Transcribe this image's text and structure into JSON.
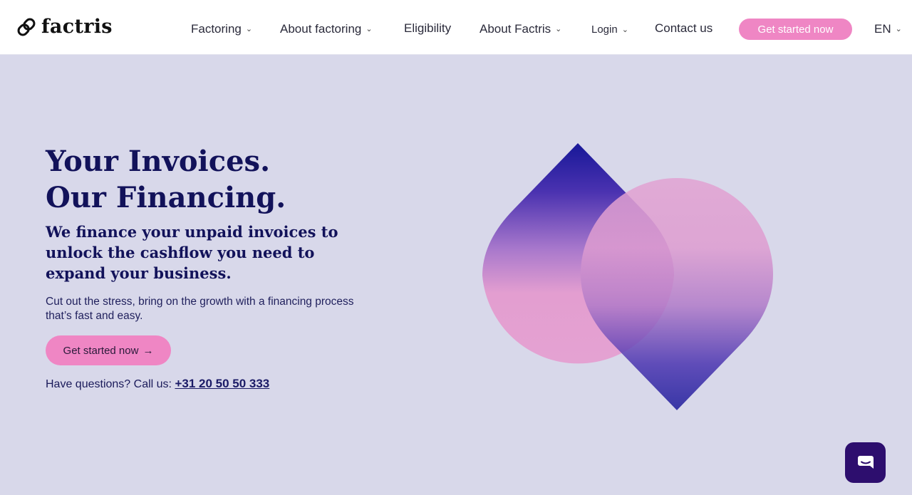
{
  "brand": {
    "name": "factris"
  },
  "nav": {
    "items": [
      {
        "label": "Factoring",
        "has_dropdown": true
      },
      {
        "label": "About factoring",
        "has_dropdown": true
      },
      {
        "label": "Eligibility",
        "has_dropdown": false
      },
      {
        "label": "About Factris",
        "has_dropdown": true
      },
      {
        "label": "Login",
        "has_dropdown": true
      },
      {
        "label": "Contact us",
        "has_dropdown": false
      }
    ],
    "cta_label": "Get started now",
    "language": "EN"
  },
  "hero": {
    "title_line1": "Your Invoices.",
    "title_line2": "Our Financing.",
    "subtitle": "We finance your unpaid invoices to unlock the cashflow you need to expand your business.",
    "description": "Cut out the stress, bring on the growth with a financing process that’s fast and easy.",
    "cta_label": "Get started now",
    "cta_arrow": "→",
    "questions_text": "Have questions? Call us:",
    "phone": "+31 20 50 50 333"
  },
  "colors": {
    "background": "#d8d8ea",
    "navy": "#12125a",
    "pink": "#ef86c4",
    "deep_purple": "#2d0e6e",
    "indigo": "#1c1a9a"
  },
  "icons": {
    "logo": "infinity-link-icon",
    "dropdown": "chevron-down-icon",
    "chat": "chat-bubble-icon"
  }
}
